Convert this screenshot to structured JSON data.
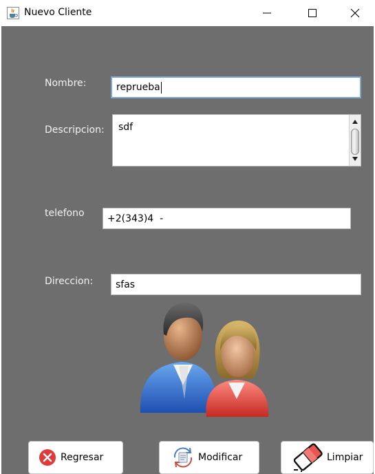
{
  "window": {
    "title": "Nuevo Cliente",
    "icon": "java-cup-icon",
    "controls": [
      "minimize-icon",
      "maximize-icon",
      "close-icon"
    ]
  },
  "form": {
    "nombre_label": "Nombre:",
    "nombre_value": "reprueba",
    "descripcion_label": "Descripcion:",
    "descripcion_value": "sdf",
    "telefono_label": "telefono",
    "telefono_value": "+2(343)4  -",
    "direccion_label": "Direccion:",
    "direccion_value": "sfas"
  },
  "illustration": {
    "icon": "clients-couple-icon"
  },
  "buttons": {
    "regresar_label": "Regresar",
    "modificar_label": "Modificar",
    "limpiar_label": "Limpiar"
  },
  "colors": {
    "panel_background": "#6e6e6e",
    "label_text": "#f2f2f2",
    "focus_border": "#7aa7d6",
    "regresar_icon": "#e03a3a"
  }
}
